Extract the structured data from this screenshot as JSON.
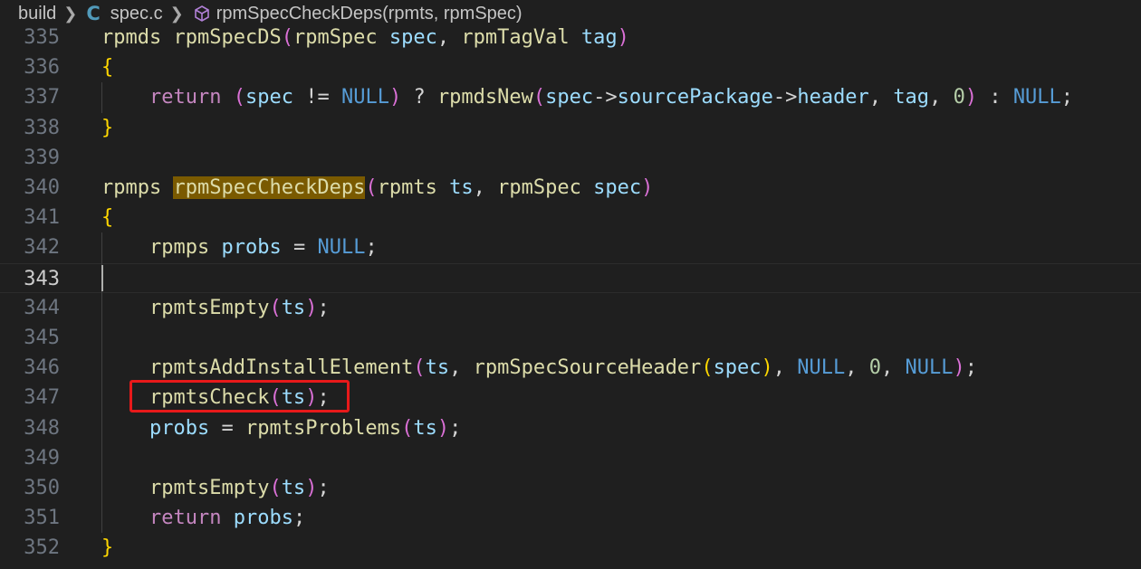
{
  "breadcrumb": {
    "items": [
      "build",
      "spec.c",
      "rpmSpecCheckDeps(rpmts, rpmSpec)"
    ],
    "icons": [
      "chevron-right-icon",
      "c-file-icon",
      "symbol-method-icon"
    ],
    "c_icon_glyph": "C"
  },
  "editor": {
    "current_line": 343,
    "highlighted_symbol": "rpmSpecCheckDeps",
    "annotation_line": 347,
    "annotation_color": "#e8191a",
    "lines": [
      {
        "n": "335",
        "text": "rpmds rpmSpecDS(rpmSpec spec, rpmTagVal tag)"
      },
      {
        "n": "336",
        "text": "{"
      },
      {
        "n": "337",
        "text": "    return (spec != NULL) ? rpmdsNew(spec->sourcePackage->header, tag, 0) : NULL;"
      },
      {
        "n": "338",
        "text": "}"
      },
      {
        "n": "339",
        "text": ""
      },
      {
        "n": "340",
        "text": "rpmps rpmSpecCheckDeps(rpmts ts, rpmSpec spec)"
      },
      {
        "n": "341",
        "text": "{"
      },
      {
        "n": "342",
        "text": "    rpmps probs = NULL;"
      },
      {
        "n": "343",
        "text": ""
      },
      {
        "n": "344",
        "text": "    rpmtsEmpty(ts);"
      },
      {
        "n": "345",
        "text": ""
      },
      {
        "n": "346",
        "text": "    rpmtsAddInstallElement(ts, rpmSpecSourceHeader(spec), NULL, 0, NULL);"
      },
      {
        "n": "347",
        "text": "    rpmtsCheck(ts);"
      },
      {
        "n": "348",
        "text": "    probs = rpmtsProblems(ts);"
      },
      {
        "n": "349",
        "text": ""
      },
      {
        "n": "350",
        "text": "    rpmtsEmpty(ts);"
      },
      {
        "n": "351",
        "text": "    return probs;"
      },
      {
        "n": "352",
        "text": "}"
      }
    ]
  }
}
